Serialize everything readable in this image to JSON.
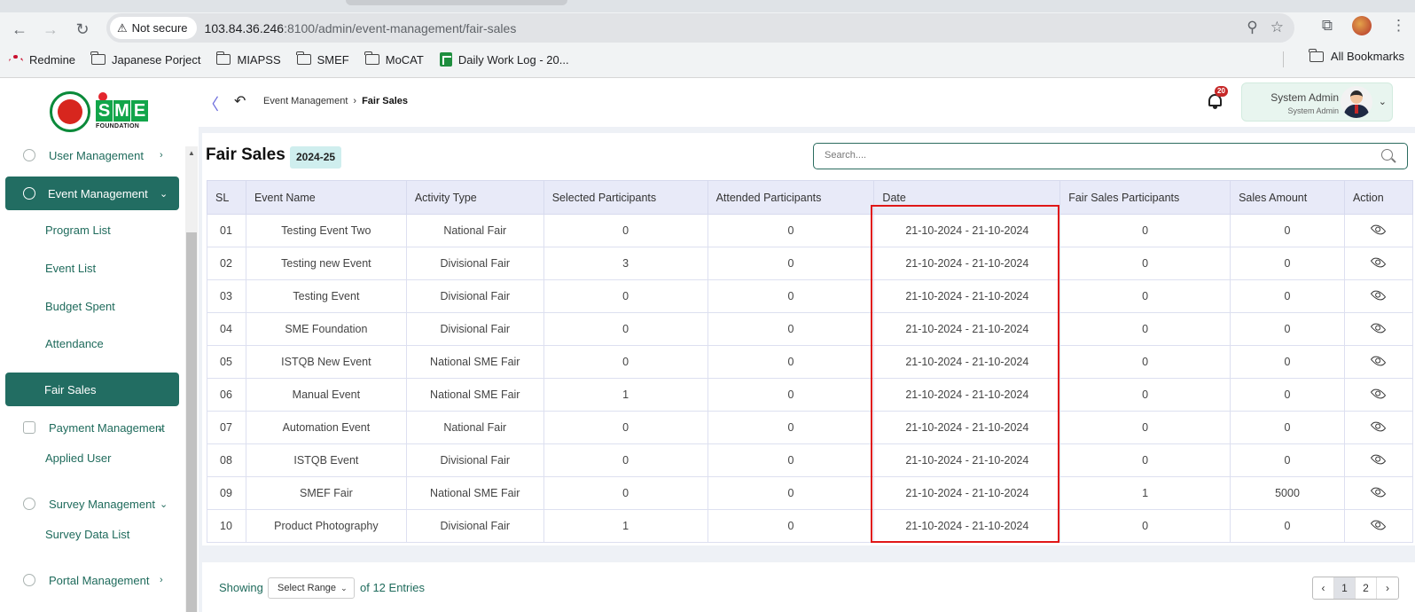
{
  "browser": {
    "security_label": "Not secure",
    "url_host": "103.84.36.246",
    "url_rest": ":8100/admin/event-management/fair-sales",
    "bookmarks": [
      "Redmine",
      "Japanese Porject",
      "MIAPSS",
      "SMEF",
      "MoCAT",
      "Daily Work Log - 20..."
    ],
    "all_bookmarks": "All Bookmarks"
  },
  "header": {
    "logo_text": "SME",
    "logo_subtext": "FOUNDATION",
    "breadcrumb": [
      "Event Management",
      "Fair Sales"
    ],
    "notification_count": "20",
    "user_name": "System Admin",
    "user_role": "System Admin"
  },
  "sidebar": {
    "items": [
      {
        "label": "User Management",
        "icon": "shield-user-icon"
      },
      {
        "label": "Event Management",
        "icon": "lock-icon",
        "active": true
      },
      {
        "label": "Program List"
      },
      {
        "label": "Event List"
      },
      {
        "label": "Budget Spent"
      },
      {
        "label": "Attendance"
      },
      {
        "label": "Fair Sales",
        "active": true
      },
      {
        "label": "Payment Management",
        "icon": "cash-icon"
      },
      {
        "label": "Applied User"
      },
      {
        "label": "Survey Management",
        "icon": "pie-chart-icon"
      },
      {
        "label": "Survey Data List"
      },
      {
        "label": "Portal Management",
        "icon": "lock-icon"
      }
    ]
  },
  "page": {
    "title": "Fair Sales",
    "year": "2024-25",
    "search_placeholder": "Search....",
    "columns": [
      "SL",
      "Event Name",
      "Activity Type",
      "Selected Participants",
      "Attended Participants",
      "Date",
      "Fair Sales Participants",
      "Sales Amount",
      "Action"
    ],
    "rows": [
      {
        "sl": "01",
        "name": "Testing Event Two",
        "type": "National Fair",
        "selected": "0",
        "attended": "0",
        "date": "21-10-2024 - 21-10-2024",
        "fair": "0",
        "amount": "0"
      },
      {
        "sl": "02",
        "name": "Testing new Event",
        "type": "Divisional Fair",
        "selected": "3",
        "attended": "0",
        "date": "21-10-2024 - 21-10-2024",
        "fair": "0",
        "amount": "0"
      },
      {
        "sl": "03",
        "name": "Testing Event",
        "type": "Divisional Fair",
        "selected": "0",
        "attended": "0",
        "date": "21-10-2024 - 21-10-2024",
        "fair": "0",
        "amount": "0"
      },
      {
        "sl": "04",
        "name": "SME Foundation",
        "type": "Divisional Fair",
        "selected": "0",
        "attended": "0",
        "date": "21-10-2024 - 21-10-2024",
        "fair": "0",
        "amount": "0"
      },
      {
        "sl": "05",
        "name": "ISTQB New Event",
        "type": "National SME Fair",
        "selected": "0",
        "attended": "0",
        "date": "21-10-2024 - 21-10-2024",
        "fair": "0",
        "amount": "0"
      },
      {
        "sl": "06",
        "name": "Manual Event",
        "type": "National SME Fair",
        "selected": "1",
        "attended": "0",
        "date": "21-10-2024 - 21-10-2024",
        "fair": "0",
        "amount": "0"
      },
      {
        "sl": "07",
        "name": "Automation Event",
        "type": "National Fair",
        "selected": "0",
        "attended": "0",
        "date": "21-10-2024 - 21-10-2024",
        "fair": "0",
        "amount": "0"
      },
      {
        "sl": "08",
        "name": "ISTQB Event",
        "type": "Divisional Fair",
        "selected": "0",
        "attended": "0",
        "date": "21-10-2024 - 21-10-2024",
        "fair": "0",
        "amount": "0"
      },
      {
        "sl": "09",
        "name": "SMEF Fair",
        "type": "National SME Fair",
        "selected": "0",
        "attended": "0",
        "date": "21-10-2024 - 21-10-2024",
        "fair": "1",
        "amount": "5000"
      },
      {
        "sl": "10",
        "name": "Product Photography",
        "type": "Divisional Fair",
        "selected": "1",
        "attended": "0",
        "date": "21-10-2024 - 21-10-2024",
        "fair": "0",
        "amount": "0"
      }
    ],
    "footer": {
      "showing": "Showing",
      "range_label": "Select Range",
      "entries_text": "of 12 Entries",
      "pages": [
        "1",
        "2"
      ]
    }
  },
  "colors": {
    "primary": "#226d62",
    "highlight": "#e01717",
    "table_header": "#e8eaf8"
  }
}
